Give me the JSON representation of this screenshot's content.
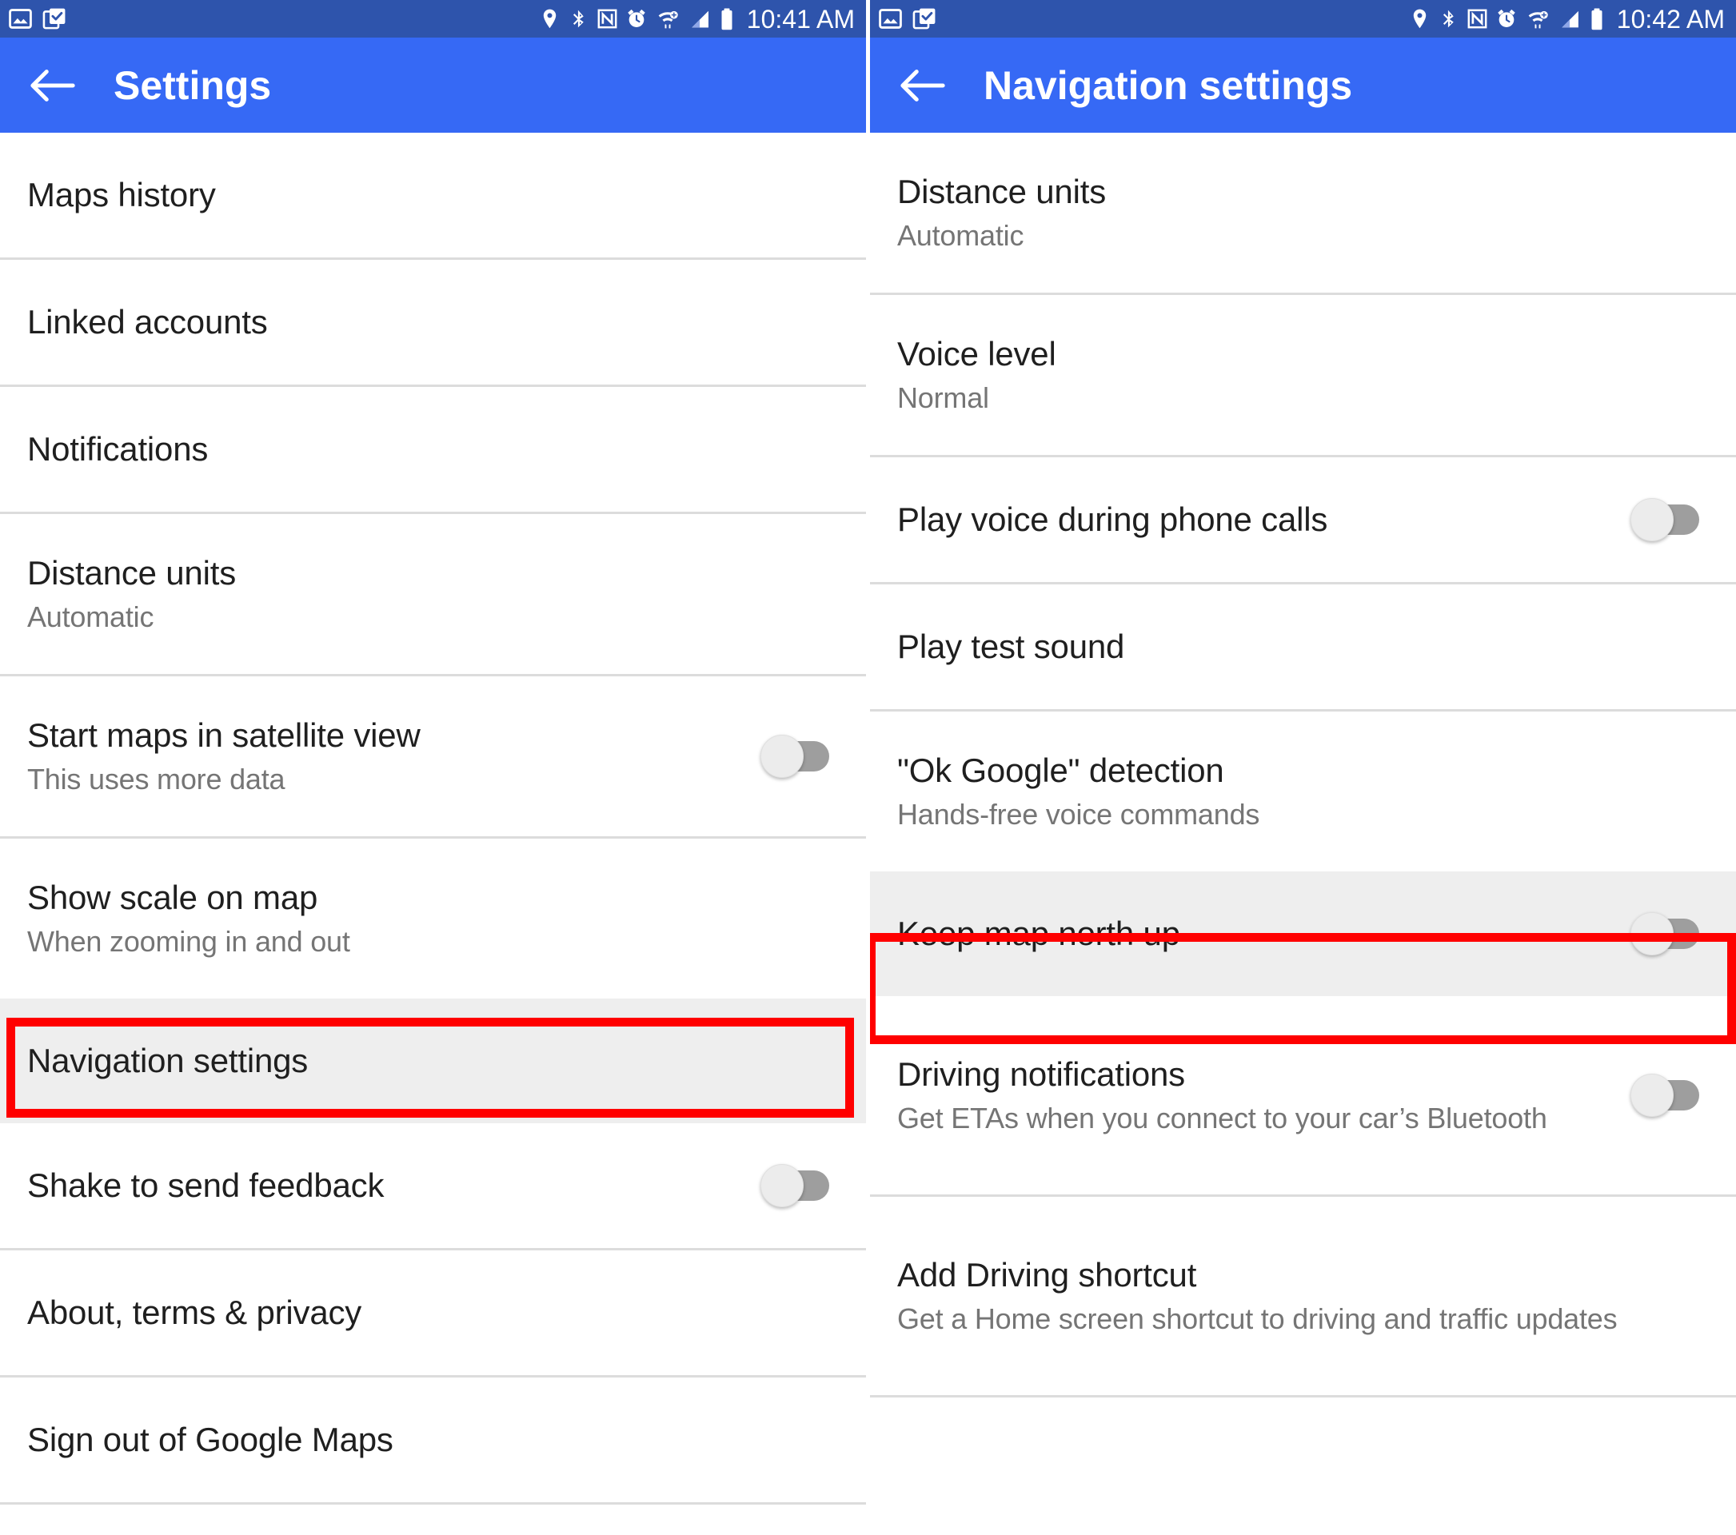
{
  "left_screen": {
    "status_bar": {
      "time": "10:41 AM",
      "notification_icons": [
        "screenshot-icon",
        "clipboard-icon"
      ],
      "system_icons": [
        "location-icon",
        "bluetooth-icon",
        "nfc-icon",
        "alarm-icon",
        "wifi-icon",
        "cell-signal-icon",
        "battery-icon"
      ]
    },
    "app_bar": {
      "back_icon": "back-arrow-icon",
      "title": "Settings"
    },
    "items": [
      {
        "title": "Maps history",
        "subtitle": "",
        "toggle": false,
        "highlighted": false
      },
      {
        "title": "Linked accounts",
        "subtitle": "",
        "toggle": false,
        "highlighted": false
      },
      {
        "title": "Notifications",
        "subtitle": "",
        "toggle": false,
        "highlighted": false
      },
      {
        "title": "Distance units",
        "subtitle": "Automatic",
        "toggle": false,
        "highlighted": false
      },
      {
        "title": "Start maps in satellite view",
        "subtitle": "This uses more data",
        "toggle": true,
        "toggle_state": "off",
        "highlighted": false
      },
      {
        "title": "Show scale on map",
        "subtitle": "When zooming in and out",
        "toggle": false,
        "highlighted": false
      },
      {
        "title": "Navigation settings",
        "subtitle": "",
        "toggle": false,
        "highlighted": true
      },
      {
        "title": "Shake to send feedback",
        "subtitle": "",
        "toggle": true,
        "toggle_state": "off",
        "highlighted": false
      },
      {
        "title": "About, terms & privacy",
        "subtitle": "",
        "toggle": false,
        "highlighted": false
      },
      {
        "title": "Sign out of Google Maps",
        "subtitle": "",
        "toggle": false,
        "highlighted": false
      }
    ]
  },
  "right_screen": {
    "status_bar": {
      "time": "10:42 AM",
      "notification_icons": [
        "screenshot-icon",
        "clipboard-icon"
      ],
      "system_icons": [
        "location-icon",
        "bluetooth-icon",
        "nfc-icon",
        "alarm-icon",
        "wifi-icon",
        "cell-signal-icon",
        "battery-icon"
      ]
    },
    "app_bar": {
      "back_icon": "back-arrow-icon",
      "title": "Navigation settings"
    },
    "items": [
      {
        "title": "Distance units",
        "subtitle": "Automatic",
        "toggle": false,
        "highlighted": false
      },
      {
        "title": "Voice level",
        "subtitle": "Normal",
        "toggle": false,
        "highlighted": false
      },
      {
        "title": "Play voice during phone calls",
        "subtitle": "",
        "toggle": true,
        "toggle_state": "off",
        "highlighted": false
      },
      {
        "title": "Play test sound",
        "subtitle": "",
        "toggle": false,
        "highlighted": false
      },
      {
        "title": "\"Ok Google\" detection",
        "subtitle": "Hands-free voice commands",
        "toggle": false,
        "highlighted": false
      },
      {
        "title": "Keep map north up",
        "subtitle": "",
        "toggle": true,
        "toggle_state": "off",
        "highlighted": true
      },
      {
        "title": "Driving notifications",
        "subtitle": "Get ETAs when you connect to your car’s Bluetooth",
        "toggle": true,
        "toggle_state": "off",
        "highlighted": false
      },
      {
        "title": "Add Driving shortcut",
        "subtitle": "Get a Home screen shortcut to driving and traffic updates",
        "toggle": false,
        "highlighted": false
      }
    ]
  },
  "theme": {
    "status_bar_color": "#2e54ac",
    "app_bar_color": "#3669f5",
    "highlight_border_color": "#ff0000",
    "highlight_row_color": "#eeeeee",
    "divider_color": "#dcdcdc",
    "title_text_color": "#1f1f1f",
    "subtitle_text_color": "#757575",
    "toggle_track_color": "#9e9e9e",
    "toggle_thumb_color": "#ececec"
  }
}
